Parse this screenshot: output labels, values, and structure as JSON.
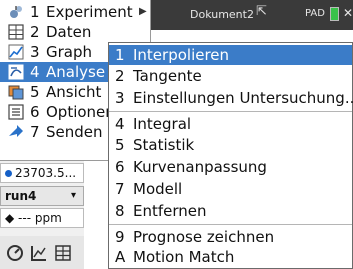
{
  "titlebar": {
    "document": "Dokument2",
    "mode": "PAD",
    "colors": {
      "bar": "#3a3a3a",
      "battery": "#39c24a"
    }
  },
  "main_menu": {
    "items": [
      {
        "num": "1",
        "label": "Experiment",
        "icon": "experiment-icon",
        "has_submenu": true
      },
      {
        "num": "2",
        "label": "Daten",
        "icon": "table-icon"
      },
      {
        "num": "3",
        "label": "Graph",
        "icon": "graph-icon"
      },
      {
        "num": "4",
        "label": "Analyse",
        "icon": "analyze-icon",
        "active": true
      },
      {
        "num": "5",
        "label": "Ansicht",
        "icon": "view-icon"
      },
      {
        "num": "6",
        "label": "Optionen",
        "icon": "options-icon"
      },
      {
        "num": "7",
        "label": "Senden",
        "icon": "send-icon"
      }
    ],
    "highlight_color": "#3b7cc8"
  },
  "left_panel": {
    "dataset_value": "23703.5...",
    "run_name": "run4",
    "sensor_readout": "--- ppm"
  },
  "submenu": {
    "items": [
      {
        "num": "1",
        "label": "Interpolieren",
        "active": true
      },
      {
        "num": "2",
        "label": "Tangente"
      },
      {
        "num": "3",
        "label": "Einstellungen Untersuchung..."
      },
      {
        "num": "4",
        "label": "Integral"
      },
      {
        "num": "5",
        "label": "Statistik"
      },
      {
        "num": "6",
        "label": "Kurvenanpassung"
      },
      {
        "num": "7",
        "label": "Modell"
      },
      {
        "num": "8",
        "label": "Entfernen"
      },
      {
        "num": "9",
        "label": "Prognose zeichnen"
      },
      {
        "num": "A",
        "label": "Motion Match"
      }
    ]
  }
}
